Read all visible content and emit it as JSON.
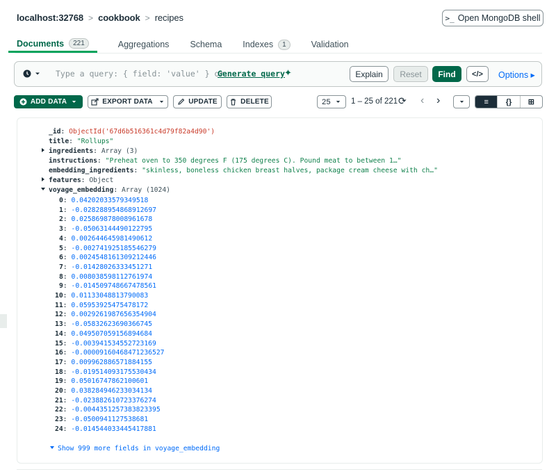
{
  "breadcrumb": {
    "host": "localhost:32768",
    "database": "cookbook",
    "collection": "recipes",
    "separator": ">"
  },
  "shell_button": {
    "icon": ">_",
    "label": "Open MongoDB shell"
  },
  "tabs": [
    {
      "label": "Documents",
      "badge": "221",
      "active": true
    },
    {
      "label": "Aggregations"
    },
    {
      "label": "Schema"
    },
    {
      "label": "Indexes",
      "badge": "1"
    },
    {
      "label": "Validation"
    }
  ],
  "query": {
    "history_icon": "clock-icon",
    "placeholder_text": "Type a query: { field: 'value' } or",
    "generate_label": "Generate query",
    "spark": "✦",
    "explain_label": "Explain",
    "reset_label": "Reset",
    "find_label": "Find",
    "code_label": "</>",
    "options_label": "Options ▸"
  },
  "toolbar": {
    "add_label": "ADD DATA",
    "export_label": "EXPORT DATA",
    "update_label": "UPDATE",
    "delete_label": "DELETE",
    "page_size": "25",
    "range": "1 – 25 of 221",
    "refresh": "⟳",
    "prev": "‹",
    "next": "›",
    "views": [
      "≡",
      "{}",
      "⊞"
    ]
  },
  "document": {
    "id_key": "_id",
    "id_value": "ObjectId('67d6b516361c4d79f82a4d90')",
    "title_key": "title",
    "title_value": "\"Rollups\"",
    "ingredients_key": "ingredients",
    "ingredients_value": "Array (3)",
    "instructions_key": "instructions",
    "instructions_value": "\"Preheat oven to 350 degrees F (175 degrees C). Pound meat to between 1…\"",
    "embedding_ingredients_key": "embedding_ingredients",
    "embedding_ingredients_value": "\"skinless, boneless chicken breast halves, package cream cheese with ch…\"",
    "features_key": "features",
    "features_value": "Object",
    "voyage_key": "voyage_embedding",
    "voyage_value": "Array (1024)",
    "embedding": [
      "0.04202033579349518",
      "-0.028288954868912697",
      "0.025869878008961678",
      "-0.05063144490122795",
      "0.002644645981490612",
      "-0.002741925185546279",
      "0.0024548161309212446",
      "-0.01428026333451271",
      "0.008038598112761974",
      "-0.014509748667478561",
      "0.01133048813790083",
      "0.05953925475478172",
      "0.0029261987656354904",
      "-0.05832623690366745",
      "0.049507059156894684",
      "-0.003941534552723169",
      "-0.00009160468471236527",
      "0.009962886571884155",
      "-0.019514093175530434",
      "0.05016747862100601",
      "0.038284946233034134",
      "-0.023882610723376274",
      "-0.0044351257383823395",
      "-0.0500941127538681",
      "-0.014544033445417881"
    ],
    "show_more": "Show 999 more fields in voyage_embedding"
  }
}
